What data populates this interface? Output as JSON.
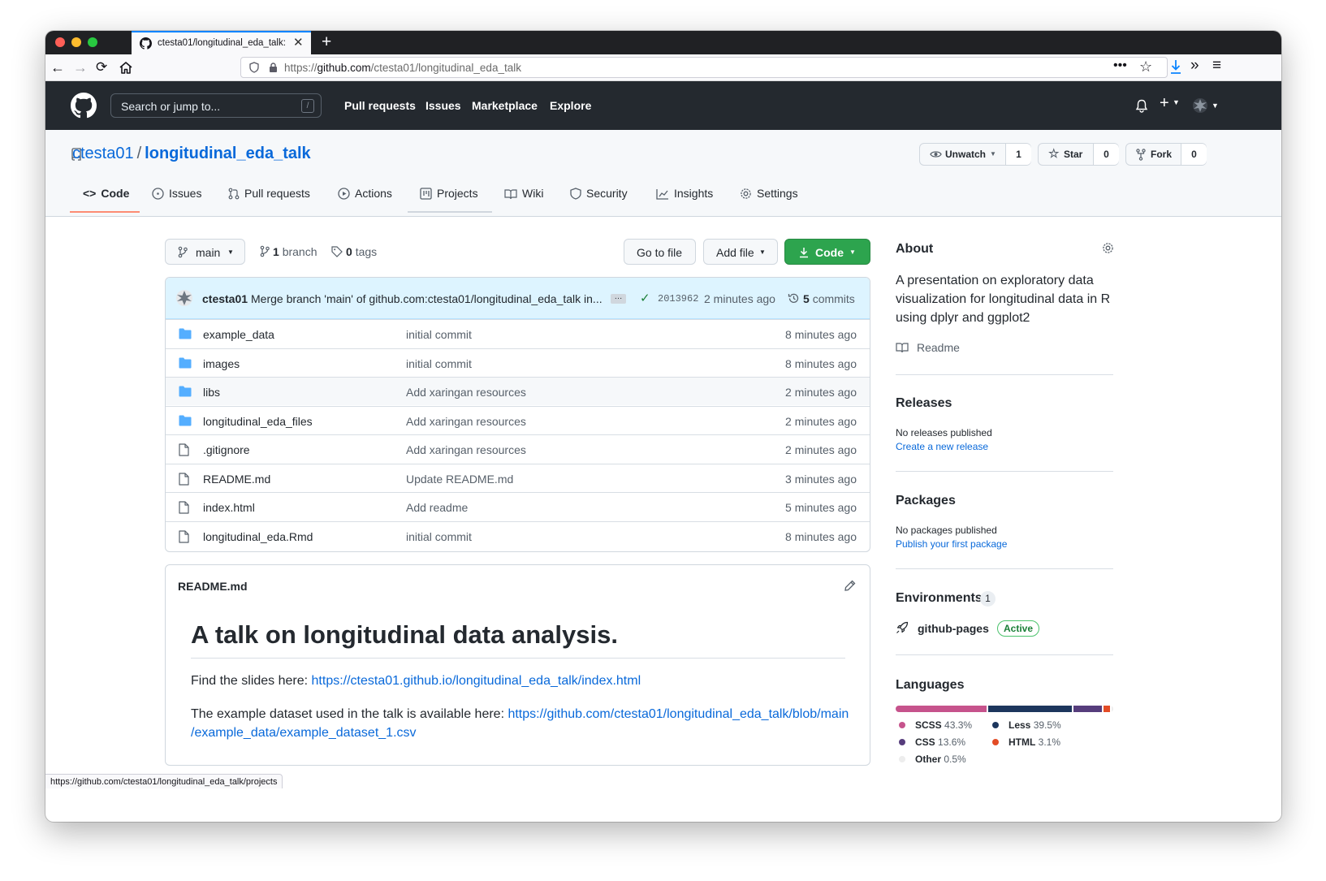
{
  "browser": {
    "tab_title": "ctesta01/longitudinal_eda_talk:",
    "url_prefix": "https://",
    "url_host": "github.com",
    "url_path": "/ctesta01/longitudinal_eda_talk",
    "status_url": "https://github.com/ctesta01/longitudinal_eda_talk/projects"
  },
  "header": {
    "search_placeholder": "Search or jump to...",
    "slash": "/",
    "nav": [
      "Pull requests",
      "Issues",
      "Marketplace",
      "Explore"
    ]
  },
  "repo": {
    "owner": "ctesta01",
    "sep": "/",
    "name": "longitudinal_eda_talk",
    "unwatch_label": "Unwatch",
    "watch_count": "1",
    "star_label": "Star",
    "star_count": "0",
    "fork_label": "Fork",
    "fork_count": "0",
    "tabs": [
      "Code",
      "Issues",
      "Pull requests",
      "Actions",
      "Projects",
      "Wiki",
      "Security",
      "Insights",
      "Settings"
    ]
  },
  "toolbar": {
    "branch": "main",
    "branches_count": "1",
    "branches_label": "branch",
    "tags_count": "0",
    "tags_label": "tags",
    "go_to_file": "Go to file",
    "add_file": "Add file",
    "code": "Code"
  },
  "commit": {
    "author": "ctesta01",
    "message": "Merge branch 'main' of github.com:ctesta01/longitudinal_eda_talk in...",
    "ellipsis": "…",
    "sha": "2013962",
    "time": "2 minutes ago",
    "commits_count": "5",
    "commits_label": "commits"
  },
  "files": [
    {
      "name": "example_data",
      "type": "dir",
      "message": "initial commit",
      "age": "8 minutes ago"
    },
    {
      "name": "images",
      "type": "dir",
      "message": "initial commit",
      "age": "8 minutes ago"
    },
    {
      "name": "libs",
      "type": "dir",
      "message": "Add xaringan resources",
      "age": "2 minutes ago"
    },
    {
      "name": "longitudinal_eda_files",
      "type": "dir",
      "message": "Add xaringan resources",
      "age": "2 minutes ago"
    },
    {
      "name": ".gitignore",
      "type": "file",
      "message": "Add xaringan resources",
      "age": "2 minutes ago"
    },
    {
      "name": "README.md",
      "type": "file",
      "message": "Update README.md",
      "age": "3 minutes ago"
    },
    {
      "name": "index.html",
      "type": "file",
      "message": "Add readme",
      "age": "5 minutes ago"
    },
    {
      "name": "longitudinal_eda.Rmd",
      "type": "file",
      "message": "initial commit",
      "age": "8 minutes ago"
    }
  ],
  "readme": {
    "filename": "README.md",
    "heading": "A talk on longitudinal data analysis.",
    "p1_text": "Find the slides here: ",
    "p1_link": "https://ctesta01.github.io/longitudinal_eda_talk/index.html",
    "p2_text": "The example dataset used in the talk is available here: ",
    "p2_link_a": "https://github.com/ctesta01/longitudinal_eda_talk/blob/main",
    "p2_link_b": "/example_data/example_dataset_1.csv"
  },
  "sidebar": {
    "about_title": "About",
    "about_l1": "A presentation on exploratory data",
    "about_l2": "visualization for longitudinal data in R",
    "about_l3": "using dplyr and ggplot2",
    "readme_label": "Readme",
    "releases_title": "Releases",
    "releases_none": "No releases published",
    "releases_link": "Create a new release",
    "packages_title": "Packages",
    "packages_none": "No packages published",
    "packages_link": "Publish your first package",
    "env_title": "Environments",
    "env_count": "1",
    "env_name": "github-pages",
    "env_status": "Active",
    "lang_title": "Languages",
    "languages": [
      {
        "name": "SCSS",
        "pct": "43.3%",
        "value": 43.3,
        "color": "#c6538c"
      },
      {
        "name": "Less",
        "pct": "39.5%",
        "value": 39.5,
        "color": "#1d365d"
      },
      {
        "name": "CSS",
        "pct": "13.6%",
        "value": 13.6,
        "color": "#563d7c"
      },
      {
        "name": "HTML",
        "pct": "3.1%",
        "value": 3.1,
        "color": "#e34c26"
      },
      {
        "name": "Other",
        "pct": "0.5%",
        "value": 0.5,
        "color": "#ededed"
      }
    ]
  },
  "colors": {
    "link": "#0969da",
    "header": "#24292f",
    "primary_button": "#2da44e",
    "tab_underline": "#fd8c73"
  }
}
